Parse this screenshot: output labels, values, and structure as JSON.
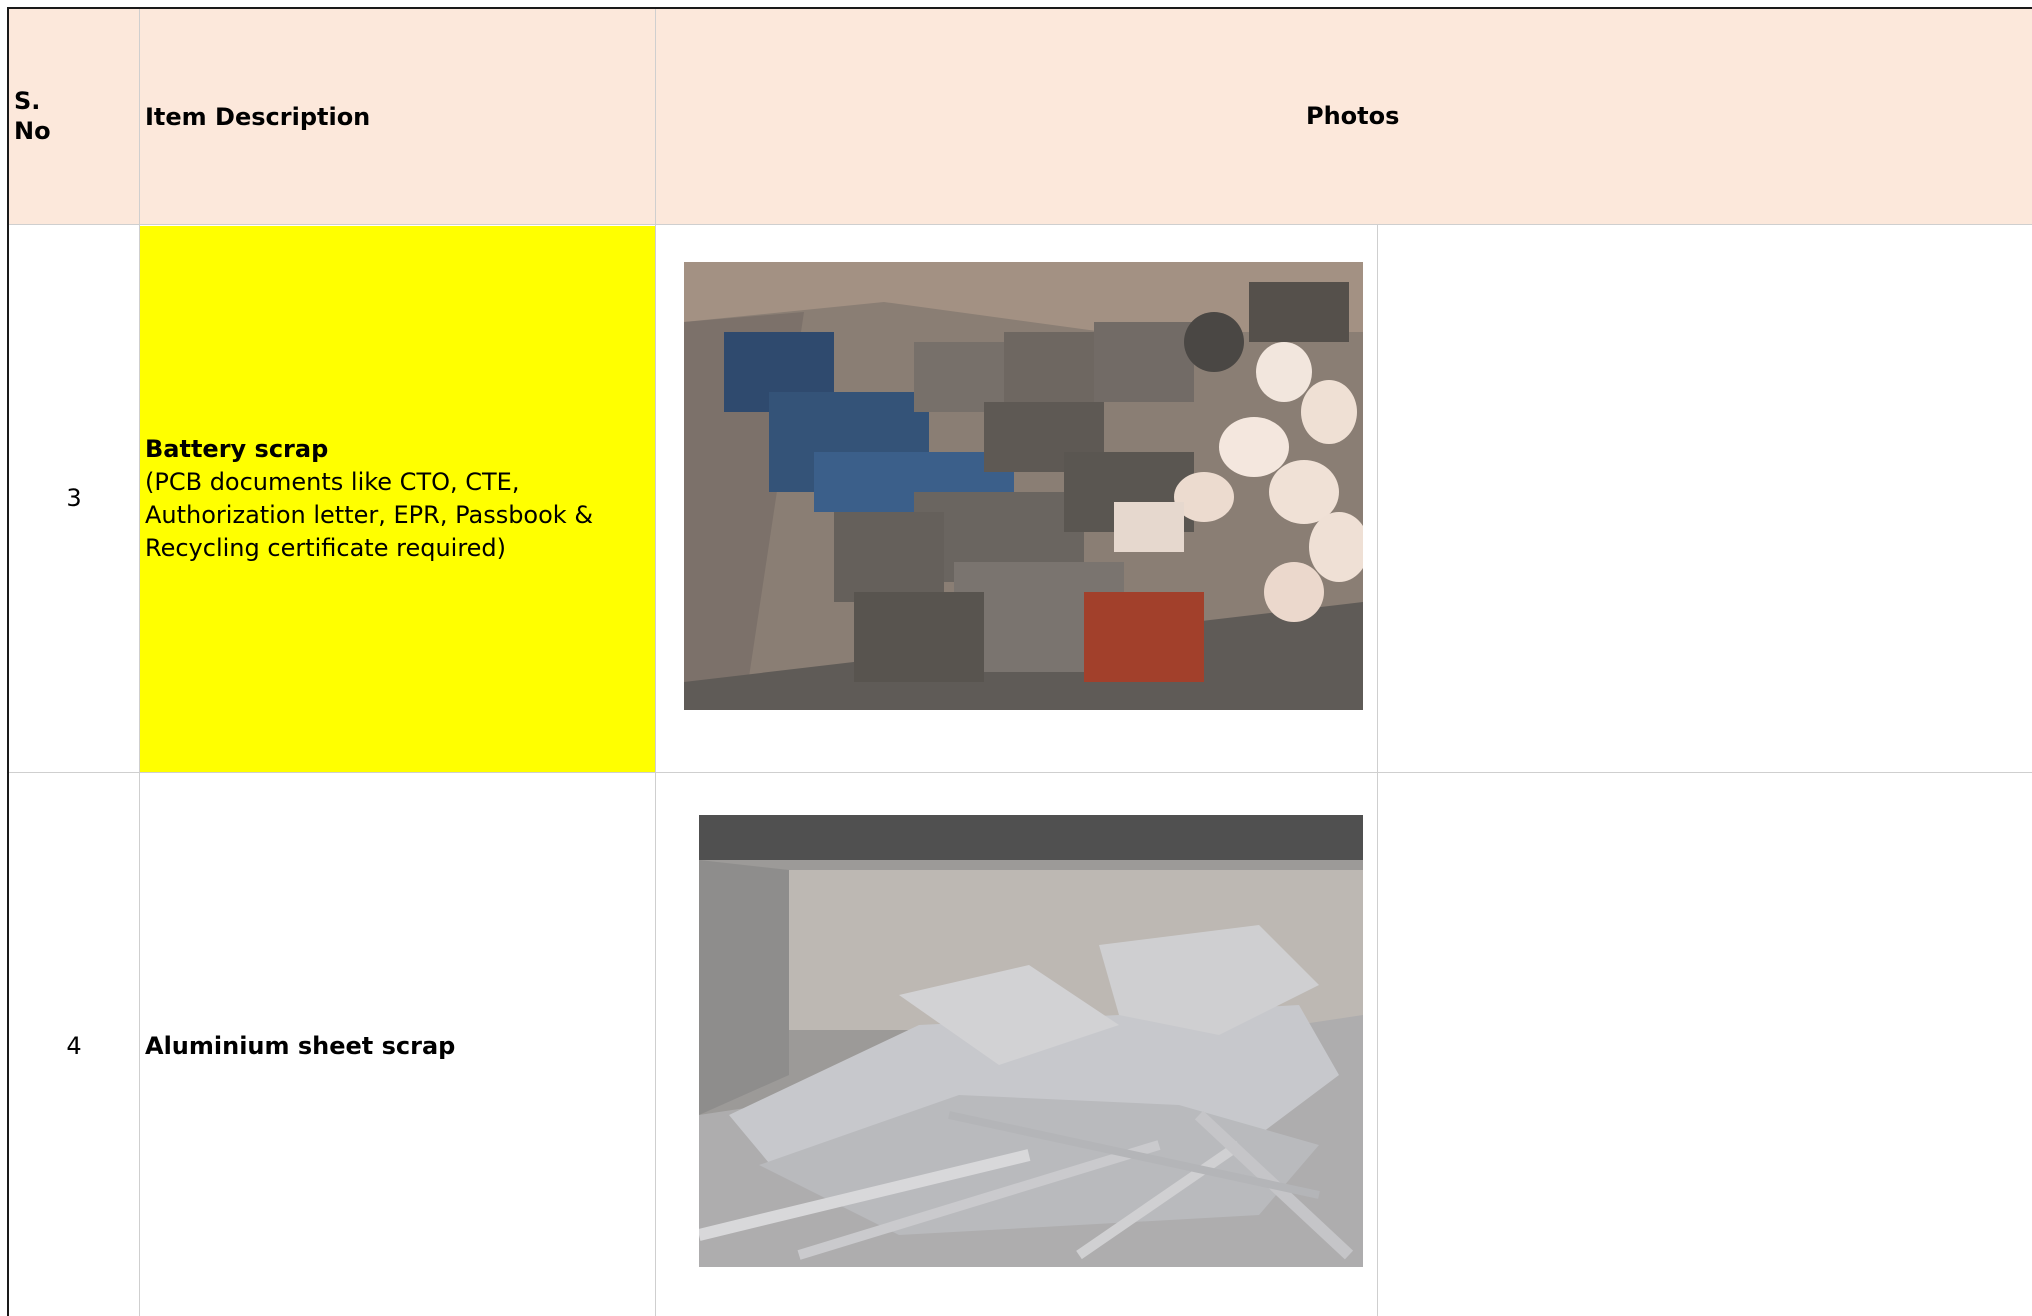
{
  "header": {
    "sno_label": "S.\nNo",
    "description_label": "Item Description",
    "photos_label": "Photos"
  },
  "rows": [
    {
      "sno": "3",
      "title": "Battery scrap",
      "note": "(PCB documents like CTO, CTE, Authorization letter, EPR, Passbook & Recycling certificate required)",
      "note_lines": [
        "(PCB documents like CTO, CTE,",
        "Authorization letter, EPR, Passbook &",
        "Recycling certificate required)"
      ],
      "highlight_color": "#ffff00",
      "photo": "battery-scrap-photo"
    },
    {
      "sno": "4",
      "title": "Aluminium sheet scrap",
      "photo": "aluminium-sheet-scrap-photo"
    }
  ],
  "colors": {
    "header_bg": "#fce8db",
    "highlight": "#ffff00",
    "grid": "#cfcfcf"
  }
}
